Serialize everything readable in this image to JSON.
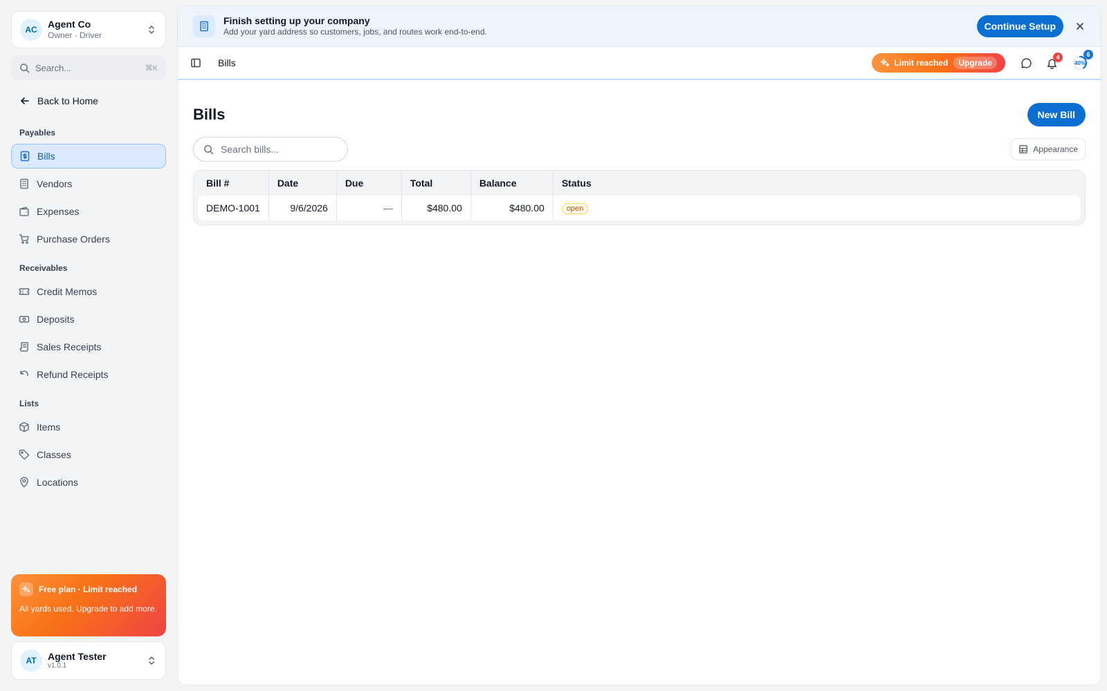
{
  "company": {
    "initials": "AC",
    "name": "Agent Co",
    "role": "Owner · Driver"
  },
  "sidebar": {
    "search_placeholder": "Search...",
    "search_shortcut": "⌘K",
    "back_label": "Back to Home",
    "sections": {
      "payables": "Payables",
      "receivables": "Receivables",
      "lists": "Lists"
    },
    "items": {
      "bills": "Bills",
      "vendors": "Vendors",
      "expenses": "Expenses",
      "purchase_orders": "Purchase Orders",
      "credit_memos": "Credit Memos",
      "deposits": "Deposits",
      "sales_receipts": "Sales Receipts",
      "refund_receipts": "Refund Receipts",
      "items_list": "Items",
      "classes": "Classes",
      "locations": "Locations"
    },
    "active_item": "bills",
    "plan": {
      "title": "Free plan · Limit reached",
      "description": "All yards used. Upgrade to add more."
    }
  },
  "user": {
    "initials": "AT",
    "name": "Agent Tester",
    "version": "v1.0.1"
  },
  "banner": {
    "title": "Finish setting up your company",
    "subtitle": "Add your yard address so customers, jobs, and routes work end-to-end.",
    "cta_label": "Continue Setup"
  },
  "topbar": {
    "breadcrumb": "Bills",
    "limit_label": "Limit reached",
    "upgrade_label": "Upgrade",
    "notifications_count": "4",
    "setup_progress_label": "40%",
    "setup_progress_fraction": 0.4,
    "setup_badge_count": "6"
  },
  "page": {
    "title": "Bills",
    "new_button_label": "New Bill",
    "search_placeholder": "Search bills...",
    "appearance_label": "Appearance"
  },
  "table": {
    "headers": {
      "bill_no": "Bill #",
      "date": "Date",
      "due": "Due",
      "total": "Total",
      "balance": "Balance",
      "status": "Status"
    },
    "rows": [
      {
        "bill_no": "DEMO-1001",
        "date": "9/6/2026",
        "due": "—",
        "total": "$480.00",
        "balance": "$480.00",
        "status": "open"
      }
    ]
  },
  "colors": {
    "primary": "#0b6fd1",
    "active_nav_bg": "#dbeafe",
    "warning_gradient_start": "#fb923c",
    "warning_gradient_end": "#ef4444",
    "status_open": "#b45309",
    "notification_badge": "#ef4444"
  },
  "icons": {
    "company_switcher": "chevrons-up-down-icon",
    "search": "search-icon",
    "back": "arrow-left-icon",
    "bills": "receipt-dollar-icon",
    "vendors": "building-icon",
    "expenses": "wallet-icon",
    "purchase_orders": "cart-icon",
    "credit_memos": "ticket-icon",
    "deposits": "banknote-icon",
    "sales_receipts": "scroll-icon",
    "refund_receipts": "undo-icon",
    "items": "box-icon",
    "classes": "tag-icon",
    "locations": "map-pin-icon",
    "setup": "building-icon",
    "close": "close-icon",
    "panel_toggle": "sidebar-toggle-icon",
    "limit": "sparkles-icon",
    "chat": "chat-bubble-icon",
    "notifications": "bell-icon",
    "appearance": "table-grid-icon"
  }
}
